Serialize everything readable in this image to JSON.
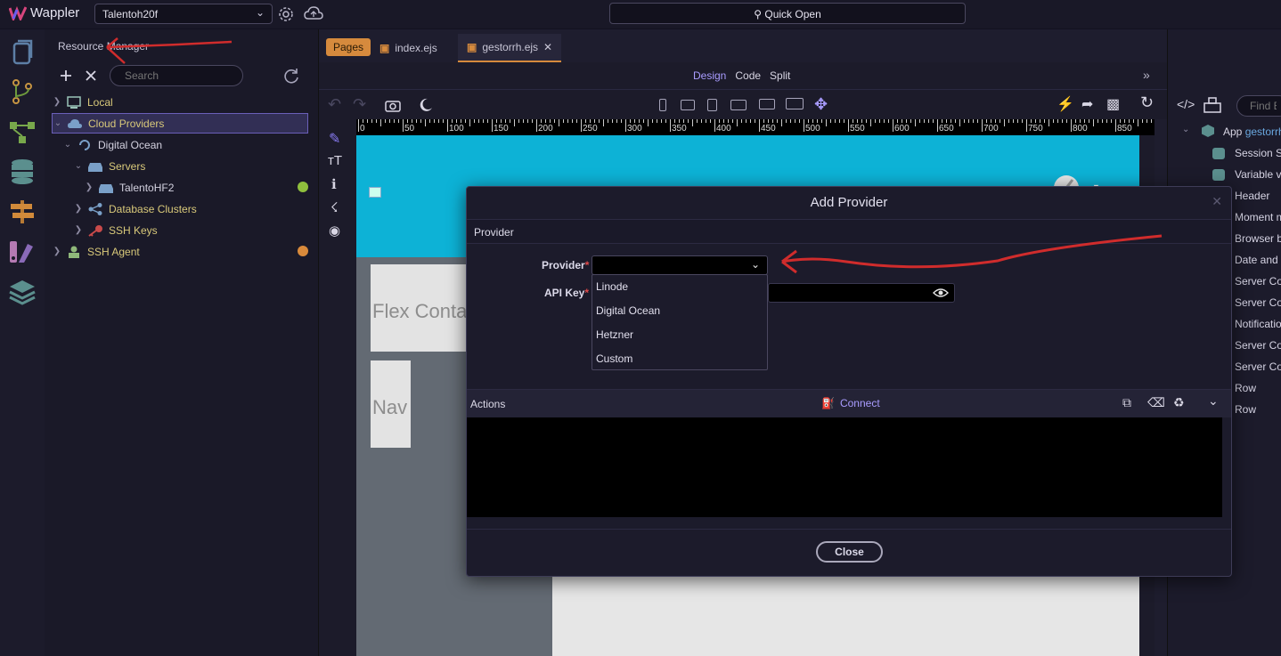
{
  "app": {
    "name": "Wappler",
    "project": "Talentoh20f",
    "quick_open": "Quick Open"
  },
  "resource_manager": {
    "title": "Resource Manager",
    "search_placeholder": "Search",
    "tree": [
      {
        "label": "Local",
        "color": "#d9c97a"
      },
      {
        "label": "Cloud Providers",
        "color": "#d9c97a"
      },
      {
        "label": "Digital Ocean",
        "color": "#d4d2e0"
      },
      {
        "label": "Servers",
        "color": "#d9c97a"
      },
      {
        "label": "TalentoHF2",
        "color": "#d4d2e0"
      },
      {
        "label": "Database Clusters",
        "color": "#d9c97a"
      },
      {
        "label": "SSH Keys",
        "color": "#d9c97a"
      },
      {
        "label": "SSH Agent",
        "color": "#d9c97a"
      }
    ]
  },
  "tabs": {
    "pages": "Pages",
    "items": [
      "index.ejs",
      "gestorrh.ejs"
    ]
  },
  "view_modes": [
    "Design",
    "Code",
    "Split"
  ],
  "ruler": [
    "0",
    "50",
    "100",
    "150",
    "200",
    "250",
    "300",
    "350",
    "400",
    "450",
    "500",
    "550",
    "600",
    "650",
    "700",
    "750",
    "800",
    "850"
  ],
  "canvas": {
    "flex_text": "Flex Conta",
    "nav_text": "Nav"
  },
  "right_panel": {
    "search_placeholder": "Find El",
    "app_label": "App",
    "app_name": "gestorrh",
    "items": [
      "Session St",
      "Variable v",
      "Header",
      "Moment m",
      "Browser b",
      "Date and T",
      "Server Con",
      "Server Con",
      "Notificatio",
      "Server Con",
      "Server Con",
      "Row",
      "Row"
    ]
  },
  "modal": {
    "title": "Add Provider",
    "section": "Provider",
    "provider_label": "Provider",
    "apikey_label": "API Key",
    "options": [
      "Linode",
      "Digital Ocean",
      "Hetzner",
      "Custom"
    ],
    "actions_label": "Actions",
    "connect_label": "Connect",
    "close_label": "Close"
  }
}
